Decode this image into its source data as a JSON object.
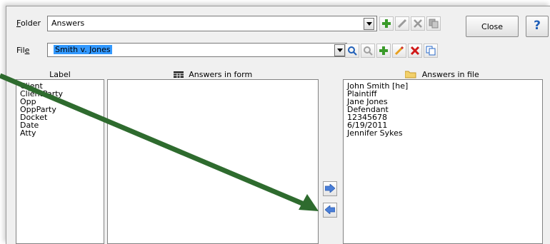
{
  "folder": {
    "label": "Folder",
    "value": "Answers"
  },
  "file": {
    "label": "File",
    "value": "Smith v. Jones"
  },
  "close_button": {
    "label": "Close"
  },
  "help_button": {
    "label": "?"
  },
  "columns": {
    "label_header": "Label",
    "answers_in_form_header": "Answers in form",
    "answers_in_file_header": "Answers in file"
  },
  "label_list": [
    "Client",
    "ClientParty",
    "Opp",
    "OppParty",
    "Docket",
    "Date",
    "Atty"
  ],
  "answers_in_file": [
    "John Smith [he]",
    "Plaintiff",
    "Jane Jones",
    "Defendant",
    "12345678",
    "6/19/2011",
    "Jennifer Sykes"
  ],
  "colors": {
    "annotation_arrow": "#2e6b2e",
    "selection": "#3399ff",
    "help_blue": "#1f5fb8"
  }
}
